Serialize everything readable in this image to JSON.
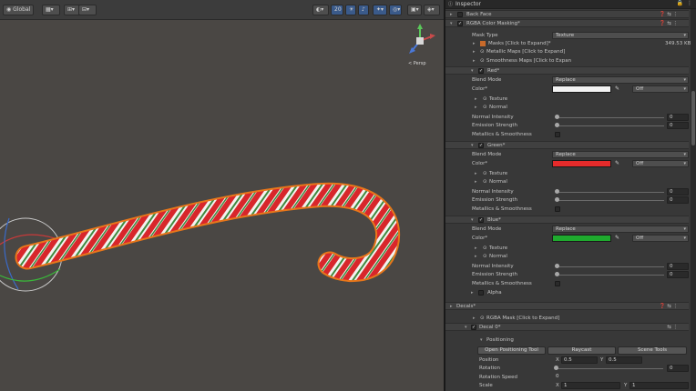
{
  "toolbar": {
    "pivot_label": "Global",
    "gizmo_count": "20",
    "persp_label": "< Persp"
  },
  "inspector": {
    "title": "Inspector",
    "back_face": "Back Face",
    "rgba_color_masking": "RGBA Color Masking*",
    "mask_type_label": "Mask Type",
    "mask_type_value": "Texture",
    "masks_label": "Masks [Click to Expand]*",
    "masks_size": "349.53 KB",
    "metallic_maps": "Metallic Maps [Click to Expand]",
    "smoothness_maps": "Smoothness Maps [Click to Expan",
    "channels": [
      {
        "name": "Red*",
        "blend_mode_label": "Blend Mode",
        "blend_mode_value": "Replace",
        "color_label": "Color*",
        "color_hex": "#f2f2f2",
        "off_value": "Off",
        "texture_label": "Texture",
        "normal_label": "Normal",
        "normal_intensity_label": "Normal Intensity",
        "normal_intensity_value": "0",
        "emission_label": "Emission Strength",
        "emission_value": "0",
        "metallics_label": "Metallics & Smoothness"
      },
      {
        "name": "Green*",
        "blend_mode_label": "Blend Mode",
        "blend_mode_value": "Replace",
        "color_label": "Color*",
        "color_hex": "#e62b2b",
        "off_value": "Off",
        "texture_label": "Texture",
        "normal_label": "Normal",
        "normal_intensity_label": "Normal Intensity",
        "normal_intensity_value": "0",
        "emission_label": "Emission Strength",
        "emission_value": "0",
        "metallics_label": "Metallics & Smoothness"
      },
      {
        "name": "Blue*",
        "blend_mode_label": "Blend Mode",
        "blend_mode_value": "Replace",
        "color_label": "Color*",
        "color_hex": "#1faa2e",
        "off_value": "Off",
        "texture_label": "Texture",
        "normal_label": "Normal",
        "normal_intensity_label": "Normal Intensity",
        "normal_intensity_value": "0",
        "emission_label": "Emission Strength",
        "emission_value": "0",
        "metallics_label": "Metallics & Smoothness"
      }
    ],
    "alpha_label": "Alpha",
    "decals_label": "Decals*",
    "rgba_mask_label": "RGBA Mask [Click to Expand]",
    "decal_0_label": "Decal 0*",
    "positioning_label": "Positioning",
    "open_positioning_tool": "Open Positioning Tool",
    "raycast_button": "Raycast",
    "scene_tools_button": "Scene Tools",
    "position_label": "Position",
    "position_x_axis": "X",
    "position_x": "0.5",
    "position_y_axis": "Y",
    "position_y": "0.5",
    "rotation_label": "Rotation",
    "rotation_value": "0",
    "rotation_speed_label": "Rotation Speed",
    "rotation_speed_value": "0",
    "scale_label": "Scale",
    "scale_x_axis": "X",
    "scale_x": "1",
    "scale_y_axis": "Y",
    "scale_y": "1"
  },
  "colors": {
    "scene_bg": "#4a4744",
    "selection_outline": "#e8761a",
    "cane_red": "#d8262b",
    "cane_green": "#3e8a3e"
  }
}
